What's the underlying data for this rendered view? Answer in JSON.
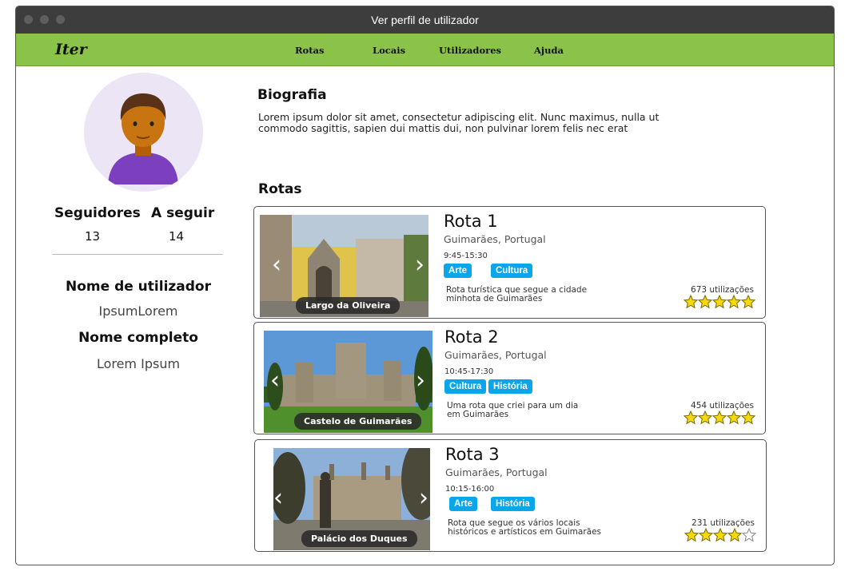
{
  "window": {
    "title": "Ver perfil de utilizador"
  },
  "nav": {
    "logo": "Iter",
    "items": [
      "Rotas",
      "Locais",
      "Utilizadores",
      "Ajuda"
    ]
  },
  "profile": {
    "followers_label": "Seguidores",
    "followers_count": "13",
    "following_label": "A seguir",
    "following_count": "14",
    "username_label": "Nome de utilizador",
    "username": "IpsumLorem",
    "fullname_label": "Nome completo",
    "fullname": "Lorem Ipsum"
  },
  "bio": {
    "title": "Biografia",
    "text": "Lorem ipsum dolor sit amet, consectetur adipiscing elit. Nunc maximus, nulla ut commodo sagittis, sapien dui mattis dui, non pulvinar lorem felis nec erat"
  },
  "routes": {
    "title": "Rotas",
    "items": [
      {
        "name": "Rota 1",
        "location": "Guimarães, Portugal",
        "time": "9:45-15:30",
        "tags": [
          "Arte",
          "Cultura"
        ],
        "description": "Rota turística que segue a cidade minhota de Guimarães",
        "uses": "673 utilizações",
        "rating": 5,
        "image_caption": "Largo da Oliveira"
      },
      {
        "name": "Rota 2",
        "location": "Guimarães, Portugal",
        "time": "10:45-17:30",
        "tags": [
          "Cultura",
          "História"
        ],
        "description": "Uma rota que criei para um dia em Guimarães",
        "uses": "454 utilizações",
        "rating": 5,
        "image_caption": "Castelo de Guimarães"
      },
      {
        "name": "Rota 3",
        "location": "Guimarães, Portugal",
        "time": "10:15-16:00",
        "tags": [
          "Arte",
          "História"
        ],
        "description": "Rota que segue os vários locais históricos e artísticos em Guimarães",
        "uses": "231 utilizações",
        "rating": 4,
        "image_caption": "Palácio dos Duques"
      }
    ]
  },
  "colors": {
    "nav_bg": "#8bc34a",
    "tag_bg": "#0aa6ec",
    "star": "#f5d90a"
  }
}
